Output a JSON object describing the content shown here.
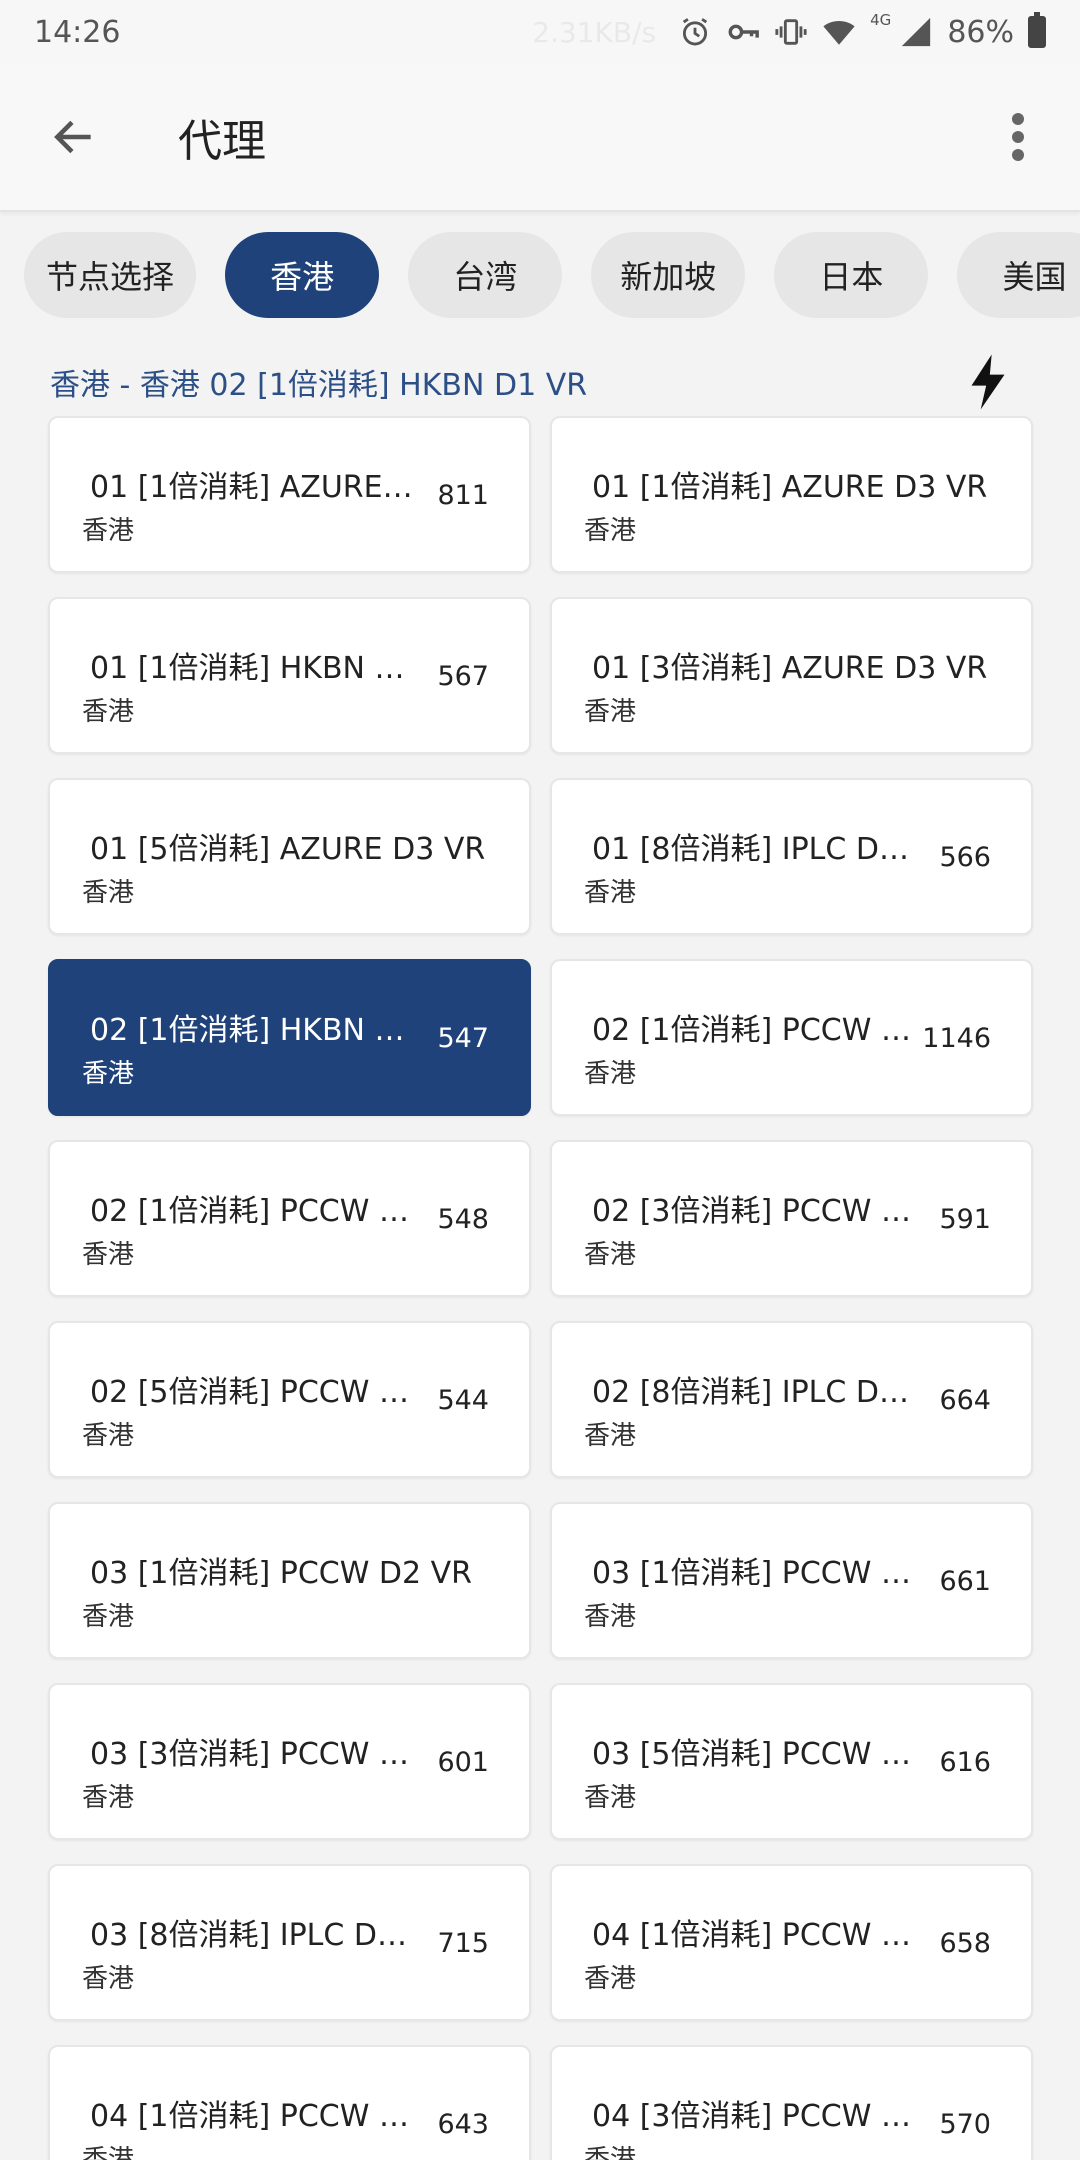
{
  "status_bar": {
    "time": "14:26",
    "speed": "2.31KB/s",
    "network": "4G",
    "battery": "86%",
    "icons": [
      "alarm-icon",
      "vpn-key-icon",
      "vibrate-icon",
      "wifi-icon",
      "signal-icon",
      "battery-icon"
    ]
  },
  "app_bar": {
    "title": "代理",
    "back_icon": "arrow-left-icon",
    "menu_icon": "more-vert-icon"
  },
  "tabs": [
    "节点选择",
    "香港",
    "台湾",
    "新加坡",
    "日本",
    "美国"
  ],
  "active_tab": "香港",
  "group": {
    "header": "香港 - 香港 02 [1倍消耗] HKBN D1 VR",
    "action_icon": "lightning-bolt-icon"
  },
  "proxies": [
    {
      "name": "01 [1倍消耗] AZURE D...",
      "region": "香港",
      "delay": "811"
    },
    {
      "name": "01 [1倍消耗] AZURE D3 VR",
      "region": "香港",
      "delay": ""
    },
    {
      "name": "01 [1倍消耗] HKBN D1...",
      "region": "香港",
      "delay": "567"
    },
    {
      "name": "01 [3倍消耗] AZURE D3 VR",
      "region": "香港",
      "delay": ""
    },
    {
      "name": "01 [5倍消耗] AZURE D3 VR",
      "region": "香港",
      "delay": ""
    },
    {
      "name": "01 [8倍消耗] IPLC D3...",
      "region": "香港",
      "delay": "566"
    },
    {
      "name": "02 [1倍消耗] HKBN D1...",
      "region": "香港",
      "delay": "547"
    },
    {
      "name": "02 [1倍消耗] PCCW D...",
      "region": "香港",
      "delay": "1146"
    },
    {
      "name": "02 [1倍消耗] PCCW D...",
      "region": "香港",
      "delay": "548"
    },
    {
      "name": "02 [3倍消耗] PCCW D...",
      "region": "香港",
      "delay": "591"
    },
    {
      "name": "02 [5倍消耗] PCCW D...",
      "region": "香港",
      "delay": "544"
    },
    {
      "name": "02 [8倍消耗] IPLC D3...",
      "region": "香港",
      "delay": "664"
    },
    {
      "name": "03 [1倍消耗] PCCW D2 VR",
      "region": "香港",
      "delay": ""
    },
    {
      "name": "03 [1倍消耗] PCCW D...",
      "region": "香港",
      "delay": "661"
    },
    {
      "name": "03 [3倍消耗] PCCW D...",
      "region": "香港",
      "delay": "601"
    },
    {
      "name": "03 [5倍消耗] PCCW D...",
      "region": "香港",
      "delay": "616"
    },
    {
      "name": "03 [8倍消耗] IPLC D3...",
      "region": "香港",
      "delay": "715"
    },
    {
      "name": "04 [1倍消耗] PCCW D...",
      "region": "香港",
      "delay": "658"
    },
    {
      "name": "04 [1倍消耗] PCCW D...",
      "region": "香港",
      "delay": "643"
    },
    {
      "name": "04 [3倍消耗] PCCW D...",
      "region": "香港",
      "delay": "570"
    }
  ],
  "selected_index": 6,
  "colors": {
    "accent": "#1e4279",
    "header_text": "#2b4f86",
    "background": "#f3f3f3"
  }
}
